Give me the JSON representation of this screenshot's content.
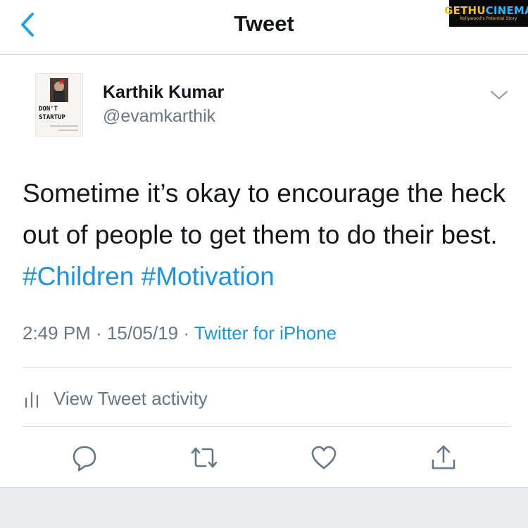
{
  "nav": {
    "title": "Tweet",
    "back_icon": "chevron-left-icon"
  },
  "watermark": {
    "part_a": "GETHU",
    "part_b": "CINEMA",
    "tagline": "Kollywood's Potential Story"
  },
  "author": {
    "display_name": "Karthik Kumar",
    "handle": "@evamkarthik",
    "avatar_text": "DON'T STARTUP"
  },
  "tweet": {
    "text": "Sometime it’s okay to encourage the heck out of people to get them to do their best. ",
    "hashtags": [
      "#Children",
      "#Motivation"
    ]
  },
  "meta": {
    "time": "2:49 PM",
    "date": "15/05/19",
    "separator": " · ",
    "source": "Twitter for iPhone"
  },
  "activity": {
    "label": "View Tweet activity",
    "icon": "bar-chart-icon"
  },
  "actions": [
    "reply-icon",
    "retweet-icon",
    "like-icon",
    "share-icon"
  ],
  "colors": {
    "link": "#1b95e0",
    "secondary_text": "#657786",
    "divider": "#d6d9dc"
  }
}
